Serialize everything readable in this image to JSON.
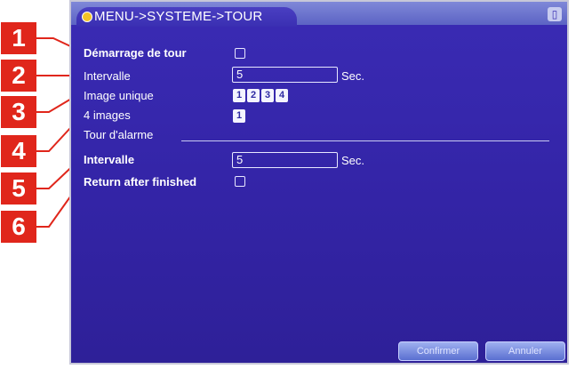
{
  "window": {
    "title": "MENU->SYSTEME->TOUR",
    "close_glyph": "▯"
  },
  "callouts": [
    "1",
    "2",
    "3",
    "4",
    "5",
    "6"
  ],
  "fields": {
    "demarrage_label": "Démarrage de tour",
    "intervalle_label": "Intervalle",
    "intervalle_value": "5",
    "intervalle_unit": "Sec.",
    "image_unique_label": "Image unique",
    "image_unique_buttons": [
      "1",
      "2",
      "3",
      "4"
    ],
    "quatre_images_label": "4 images",
    "quatre_images_button": "1",
    "alarm_section_label": "Tour d'alarme",
    "alarm_intervalle_label": "Intervalle",
    "alarm_intervalle_value": "5",
    "alarm_intervalle_unit": "Sec.",
    "return_label": "Return after finished"
  },
  "buttons": {
    "confirm_label": "Confirmer",
    "cancel_label": "Annuler"
  },
  "colors": {
    "callout": "#e0261b",
    "panel": "#3324a6"
  }
}
